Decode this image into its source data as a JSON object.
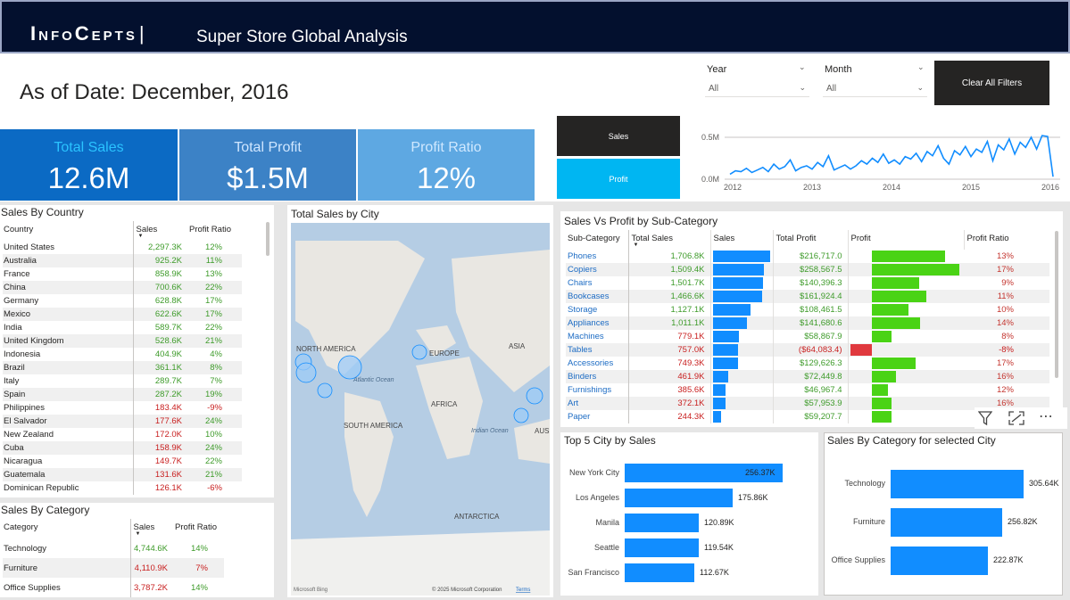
{
  "header": {
    "brand": "InfoCepts",
    "separator": "|",
    "title": "Super Store Global Analysis"
  },
  "as_of": "As of Date: December, 2016",
  "slicers": [
    {
      "label": "Year",
      "value": "All"
    },
    {
      "label": "Month",
      "value": "All"
    }
  ],
  "clear_filters": "Clear All Filters",
  "kpis": [
    {
      "label": "Total Sales",
      "value": "12.6M"
    },
    {
      "label": "Total Profit",
      "value": "$1.5M"
    },
    {
      "label": "Profit Ratio",
      "value": "12%"
    }
  ],
  "toggle": {
    "sales": "Sales",
    "profit": "Profit"
  },
  "trend": {
    "y_ticks": [
      "0.5M",
      "0.0M"
    ],
    "x_ticks": [
      "2012",
      "2013",
      "2014",
      "2015",
      "2016"
    ],
    "chart_data": {
      "type": "line",
      "series": [
        {
          "values": [
            0.06,
            0.1,
            0.09,
            0.13,
            0.08,
            0.11,
            0.14,
            0.09,
            0.18,
            0.12,
            0.15,
            0.23,
            0.1,
            0.14,
            0.16,
            0.12,
            0.2,
            0.15,
            0.28,
            0.11,
            0.14,
            0.17,
            0.12,
            0.16,
            0.22,
            0.18,
            0.25,
            0.2,
            0.3,
            0.19,
            0.23,
            0.18,
            0.27,
            0.24,
            0.31,
            0.21,
            0.33,
            0.28,
            0.4,
            0.25,
            0.18,
            0.34,
            0.29,
            0.39,
            0.27,
            0.36,
            0.32,
            0.45,
            0.22,
            0.41,
            0.35,
            0.48,
            0.3,
            0.44,
            0.38,
            0.5,
            0.36,
            0.52,
            0.51,
            0.03
          ]
        }
      ],
      "ylim": [
        0,
        0.55
      ]
    }
  },
  "country": {
    "title": "Sales By Country",
    "headers": [
      "Country",
      "Sales",
      "Profit Ratio"
    ],
    "rows": [
      [
        "United States",
        "2,297.3K",
        "12%"
      ],
      [
        "Australia",
        "925.2K",
        "11%"
      ],
      [
        "France",
        "858.9K",
        "13%"
      ],
      [
        "China",
        "700.6K",
        "22%"
      ],
      [
        "Germany",
        "628.8K",
        "17%"
      ],
      [
        "Mexico",
        "622.6K",
        "17%"
      ],
      [
        "India",
        "589.7K",
        "22%"
      ],
      [
        "United Kingdom",
        "528.6K",
        "21%"
      ],
      [
        "Indonesia",
        "404.9K",
        "4%"
      ],
      [
        "Brazil",
        "361.1K",
        "8%"
      ],
      [
        "Italy",
        "289.7K",
        "7%"
      ],
      [
        "Spain",
        "287.2K",
        "19%"
      ],
      [
        "Philippines",
        "183.4K",
        "-9%"
      ],
      [
        "El Salvador",
        "177.6K",
        "24%"
      ],
      [
        "New Zealand",
        "172.0K",
        "10%"
      ],
      [
        "Cuba",
        "158.9K",
        "24%"
      ],
      [
        "Nicaragua",
        "149.7K",
        "22%"
      ],
      [
        "Guatemala",
        "131.6K",
        "21%"
      ],
      [
        "Dominican Republic",
        "126.1K",
        "-6%"
      ]
    ]
  },
  "category": {
    "title": "Sales By Category",
    "headers": [
      "Category",
      "Sales",
      "Profit Ratio"
    ],
    "rows": [
      [
        "Technology",
        "4,744.6K",
        "14%"
      ],
      [
        "Furniture",
        "4,110.9K",
        "7%"
      ],
      [
        "Office Supplies",
        "3,787.2K",
        "14%"
      ]
    ]
  },
  "map": {
    "title": "Total Sales by City",
    "labels": {
      "na": "NORTH AMERICA",
      "europe": "EUROPE",
      "asia": "ASIA",
      "atlantic": "Atlantic Ocean",
      "africa": "AFRICA",
      "sa": "SOUTH AMERICA",
      "indian": "Indian Ocean",
      "aus": "AUS",
      "antarctica": "ANTARCTICA"
    },
    "footer_brand": "Microsoft Bing",
    "footer_copy": "© 2025 Microsoft Corporation",
    "footer_terms": "Terms"
  },
  "subcat": {
    "title": "Sales Vs Profit by Sub-Category",
    "headers": [
      "Sub-Category",
      "Total Sales",
      "Sales",
      "Total Profit",
      "Profit",
      "Profit Ratio"
    ],
    "rows": [
      [
        "Phones",
        "1,706.8K",
        "$216,717.0",
        "13%",
        1706.8,
        216717.0
      ],
      [
        "Copiers",
        "1,509.4K",
        "$258,567.5",
        "17%",
        1509.4,
        258567.5
      ],
      [
        "Chairs",
        "1,501.7K",
        "$140,396.3",
        "9%",
        1501.7,
        140396.3
      ],
      [
        "Bookcases",
        "1,466.6K",
        "$161,924.4",
        "11%",
        1466.6,
        161924.4
      ],
      [
        "Storage",
        "1,127.1K",
        "$108,461.5",
        "10%",
        1127.1,
        108461.5
      ],
      [
        "Appliances",
        "1,011.1K",
        "$141,680.6",
        "14%",
        1011.1,
        141680.6
      ],
      [
        "Machines",
        "779.1K",
        "$58,867.9",
        "8%",
        779.1,
        58867.9
      ],
      [
        "Tables",
        "757.0K",
        "($64,083.4)",
        "-8%",
        757.0,
        -64083.4
      ],
      [
        "Accessories",
        "749.3K",
        "$129,626.3",
        "17%",
        749.3,
        129626.3
      ],
      [
        "Binders",
        "461.9K",
        "$72,449.8",
        "16%",
        461.9,
        72449.8
      ],
      [
        "Furnishings",
        "385.6K",
        "$46,967.4",
        "12%",
        385.6,
        46967.4
      ],
      [
        "Art",
        "372.1K",
        "$57,953.9",
        "16%",
        372.1,
        57953.9
      ],
      [
        "Paper",
        "244.3K",
        "$59,207.7",
        "16%",
        244.3,
        59207.7
      ]
    ]
  },
  "top5": {
    "title": "Top 5 City by Sales",
    "chart_data": {
      "type": "bar",
      "categories": [
        "New York City",
        "Los Angeles",
        "Manila",
        "Seattle",
        "San Francisco"
      ],
      "values": [
        256.37,
        175.86,
        120.89,
        119.54,
        112.67
      ],
      "labels": [
        "256.37K",
        "175.86K",
        "120.89K",
        "119.54K",
        "112.67K"
      ]
    }
  },
  "catcity": {
    "title": "Sales By Category for selected City",
    "chart_data": {
      "type": "bar",
      "categories": [
        "Technology",
        "Furniture",
        "Office Supplies"
      ],
      "values": [
        305.64,
        256.82,
        222.87
      ],
      "labels": [
        "305.64K",
        "256.82K",
        "222.87K"
      ]
    }
  },
  "colors": {
    "bar": "#118dff",
    "pos": "#4ad315",
    "neg": "#e0393e",
    "accent": "#0b6ac4"
  }
}
